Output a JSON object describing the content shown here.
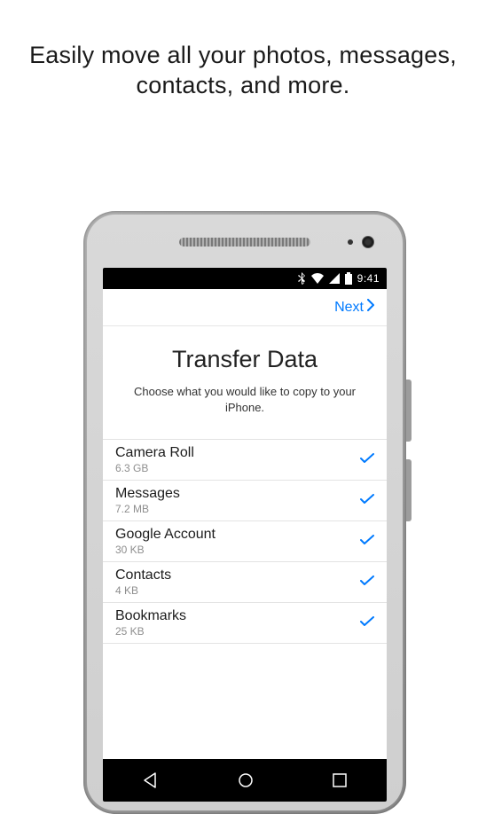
{
  "headline": "Easily move all your photos, messages, contacts, and more.",
  "statusbar": {
    "time": "9:41"
  },
  "appbar": {
    "next": "Next"
  },
  "screen": {
    "title": "Transfer Data",
    "subtitle": "Choose what you would like to copy to your iPhone."
  },
  "items": [
    {
      "name": "Camera Roll",
      "size": "6.3 GB"
    },
    {
      "name": "Messages",
      "size": "7.2 MB"
    },
    {
      "name": "Google Account",
      "size": "30 KB"
    },
    {
      "name": "Contacts",
      "size": "4 KB"
    },
    {
      "name": "Bookmarks",
      "size": "25 KB"
    }
  ]
}
